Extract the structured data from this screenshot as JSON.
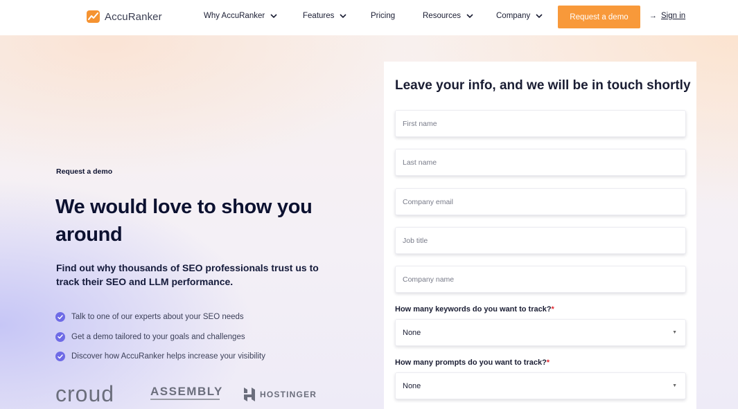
{
  "brand": {
    "name": "AccuRanker",
    "accent_color": "#f8993a",
    "check_color": "#6e6ae6"
  },
  "nav": {
    "items": [
      {
        "label": "Why AccuRanker",
        "has_dropdown": true
      },
      {
        "label": "Features",
        "has_dropdown": true
      },
      {
        "label": "Pricing",
        "has_dropdown": false
      },
      {
        "label": "Resources",
        "has_dropdown": true
      },
      {
        "label": "Company",
        "has_dropdown": true
      }
    ],
    "cta_label": "Request a demo",
    "signin_arrow": "→",
    "signin_label": "Sign in"
  },
  "hero": {
    "eyebrow": "Request a demo",
    "headline": "We would love to show you around",
    "subheadline": "Find out why thousands of SEO professionals trust us to track their SEO and LLM performance.",
    "bullets": [
      "Talk to one of our experts about your SEO needs",
      "Get a demo tailored to your goals and challenges",
      "Discover how AccuRanker helps increase your visibility"
    ]
  },
  "customer_logos": {
    "croud": "croud",
    "assembly": "ASSEMBLY",
    "hostinger": "HOSTINGER"
  },
  "form": {
    "title": "Leave your info, and we will be in touch shortly",
    "fields": {
      "first_name": "First name",
      "last_name": "Last name",
      "company_email": "Company email",
      "job_title": "Job title",
      "company_name": "Company name"
    },
    "keywords_question": "How many keywords do you want to track?",
    "keywords_value": "None",
    "prompts_question": "How many prompts do you want to track?",
    "prompts_value": "None",
    "required_mark": "*"
  }
}
